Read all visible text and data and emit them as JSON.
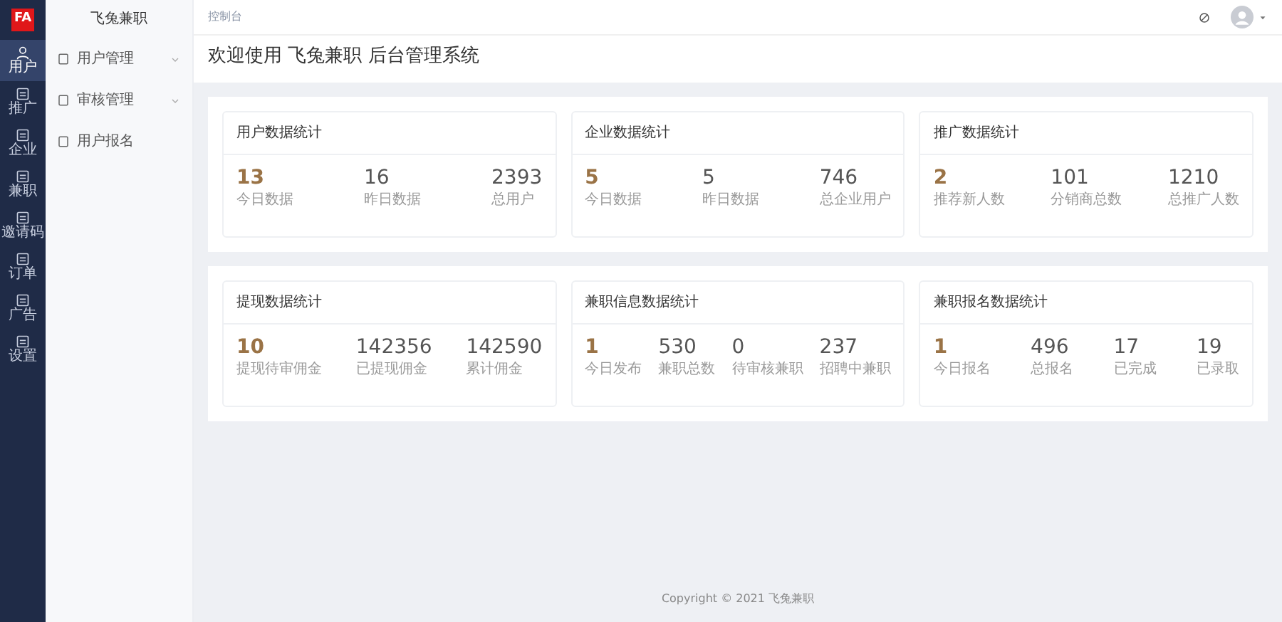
{
  "logo": {
    "text": "FA"
  },
  "rail": [
    {
      "label": "用户",
      "selected": true
    },
    {
      "label": "推广",
      "selected": false
    },
    {
      "label": "企业",
      "selected": false
    },
    {
      "label": "兼职",
      "selected": false
    },
    {
      "label": "邀请码",
      "selected": false
    },
    {
      "label": "订单",
      "selected": false
    },
    {
      "label": "广告",
      "selected": false
    },
    {
      "label": "设置",
      "selected": false
    }
  ],
  "sidebar": {
    "title": "飞兔兼职",
    "items": [
      {
        "label": "用户管理",
        "expandable": true
      },
      {
        "label": "审核管理",
        "expandable": true
      },
      {
        "label": "用户报名",
        "expandable": false
      }
    ]
  },
  "breadcrumb": "控制台",
  "page_title": "欢迎使用 飞兔兼职 后台管理系统",
  "panels": [
    {
      "cards": [
        {
          "title": "用户数据统计",
          "stats": [
            {
              "value": "13",
              "label": "今日数据"
            },
            {
              "value": "16",
              "label": "昨日数据"
            },
            {
              "value": "2393",
              "label": "总用户"
            }
          ]
        },
        {
          "title": "企业数据统计",
          "stats": [
            {
              "value": "5",
              "label": "今日数据"
            },
            {
              "value": "5",
              "label": "昨日数据"
            },
            {
              "value": "746",
              "label": "总企业用户"
            }
          ]
        },
        {
          "title": "推广数据统计",
          "stats": [
            {
              "value": "2",
              "label": "推荐新人数"
            },
            {
              "value": "101",
              "label": "分销商总数"
            },
            {
              "value": "1210",
              "label": "总推广人数"
            }
          ]
        }
      ]
    },
    {
      "cards": [
        {
          "title": "提现数据统计",
          "stats": [
            {
              "value": "10",
              "label": "提现待审佣金"
            },
            {
              "value": "142356",
              "label": "已提现佣金"
            },
            {
              "value": "142590",
              "label": "累计佣金"
            }
          ]
        },
        {
          "title": "兼职信息数据统计",
          "stats": [
            {
              "value": "1",
              "label": "今日发布"
            },
            {
              "value": "530",
              "label": "兼职总数"
            },
            {
              "value": "0",
              "label": "待审核兼职"
            },
            {
              "value": "237",
              "label": "招聘中兼职"
            }
          ]
        },
        {
          "title": "兼职报名数据统计",
          "stats": [
            {
              "value": "1",
              "label": "今日报名"
            },
            {
              "value": "496",
              "label": "总报名"
            },
            {
              "value": "17",
              "label": "已完成"
            },
            {
              "value": "19",
              "label": "已录取"
            }
          ]
        }
      ]
    }
  ],
  "footer": "Copyright © 2021 飞兔兼职"
}
